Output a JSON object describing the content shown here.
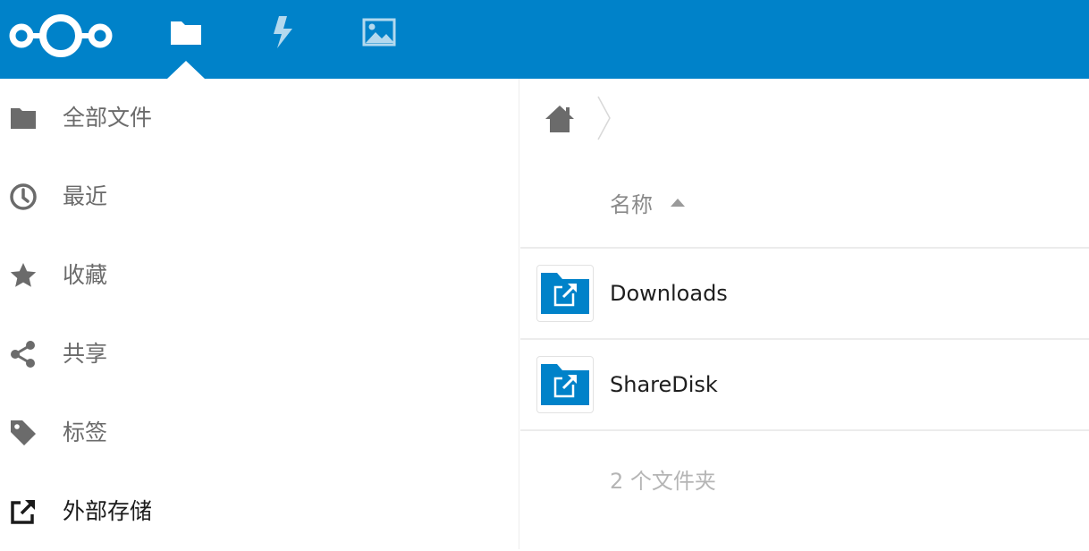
{
  "header": {
    "logo": "nextcloud-logo",
    "apps": [
      {
        "name": "files",
        "icon": "folder-icon",
        "active": true
      },
      {
        "name": "activity",
        "icon": "lightning-icon",
        "active": false
      },
      {
        "name": "gallery",
        "icon": "image-icon",
        "active": false
      }
    ],
    "accent_color": "#0082c9"
  },
  "sidebar": {
    "items": [
      {
        "label": "全部文件",
        "icon": "folder-icon"
      },
      {
        "label": "最近",
        "icon": "clock-icon"
      },
      {
        "label": "收藏",
        "icon": "star-icon"
      },
      {
        "label": "共享",
        "icon": "share-icon"
      },
      {
        "label": "标签",
        "icon": "tag-icon"
      },
      {
        "label": "外部存储",
        "icon": "external-link-icon",
        "active": true
      }
    ]
  },
  "main": {
    "breadcrumb": {
      "home_icon": "home-icon"
    },
    "column_header": {
      "name_label": "名称",
      "sort": "ascending"
    },
    "files": [
      {
        "name": "Downloads",
        "icon": "external-folder-icon"
      },
      {
        "name": "ShareDisk",
        "icon": "external-folder-icon"
      }
    ],
    "summary": "2 个文件夹"
  }
}
